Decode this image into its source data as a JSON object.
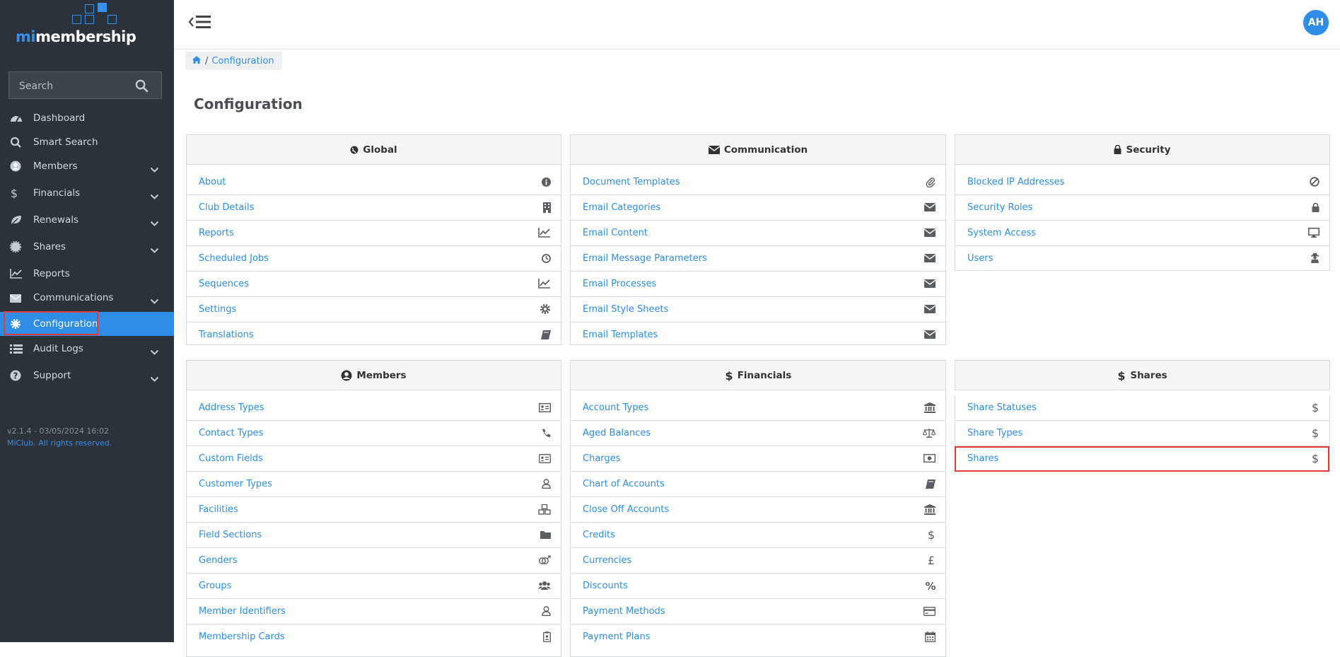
{
  "logo": {
    "mi": "mi",
    "rest": "membership"
  },
  "search": {
    "placeholder": "Search"
  },
  "nav": [
    {
      "label": "Dashboard",
      "icon": "dashboard-icon",
      "chevron": false
    },
    {
      "label": "Smart Search",
      "icon": "search-icon",
      "chevron": false
    },
    {
      "label": "Members",
      "icon": "user-circle-icon",
      "chevron": true
    },
    {
      "label": "Financials",
      "icon": "dollar-icon",
      "chevron": true
    },
    {
      "label": "Renewals",
      "icon": "leaf-icon",
      "chevron": true
    },
    {
      "label": "Shares",
      "icon": "certificate-icon",
      "chevron": true
    },
    {
      "label": "Reports",
      "icon": "line-chart-icon",
      "chevron": false
    },
    {
      "label": "Communications",
      "icon": "envelope-icon",
      "chevron": true
    },
    {
      "label": "Configuration",
      "icon": "gear-icon",
      "chevron": false,
      "active": true
    },
    {
      "label": "Audit Logs",
      "icon": "list-icon",
      "chevron": true
    },
    {
      "label": "Support",
      "icon": "question-circle-icon",
      "chevron": true
    }
  ],
  "version": {
    "text": "v2.1.4 - 03/05/2024 16:02",
    "copyright": "MiClub. All rights reserved."
  },
  "user": {
    "initials": "AH"
  },
  "breadcrumb": {
    "current": "Configuration"
  },
  "page": {
    "title": "Configuration"
  },
  "panels": [
    {
      "key": "global",
      "title": "Global",
      "icon": "globe-icon",
      "items": [
        {
          "label": "About",
          "icon": "info-circle-icon"
        },
        {
          "label": "Club Details",
          "icon": "building-icon"
        },
        {
          "label": "Reports",
          "icon": "line-chart-icon"
        },
        {
          "label": "Scheduled Jobs",
          "icon": "clock-icon"
        },
        {
          "label": "Sequences",
          "icon": "line-chart-icon"
        },
        {
          "label": "Settings",
          "icon": "gear-icon"
        },
        {
          "label": "Translations",
          "icon": "book-icon"
        }
      ]
    },
    {
      "key": "communication",
      "title": "Communication",
      "icon": "envelope-icon",
      "items": [
        {
          "label": "Document Templates",
          "icon": "paperclip-icon"
        },
        {
          "label": "Email Categories",
          "icon": "envelope-icon"
        },
        {
          "label": "Email Content",
          "icon": "envelope-icon"
        },
        {
          "label": "Email Message Parameters",
          "icon": "envelope-icon"
        },
        {
          "label": "Email Processes",
          "icon": "envelope-icon"
        },
        {
          "label": "Email Style Sheets",
          "icon": "envelope-icon"
        },
        {
          "label": "Email Templates",
          "icon": "envelope-icon"
        }
      ]
    },
    {
      "key": "security",
      "title": "Security",
      "icon": "lock-icon",
      "items": [
        {
          "label": "Blocked IP Addresses",
          "icon": "ban-icon"
        },
        {
          "label": "Security Roles",
          "icon": "lock-icon"
        },
        {
          "label": "System Access",
          "icon": "desktop-icon"
        },
        {
          "label": "Users",
          "icon": "user-secret-icon"
        }
      ]
    },
    {
      "key": "members",
      "title": "Members",
      "icon": "user-circle-icon",
      "items": [
        {
          "label": "Address Types",
          "icon": "address-card-icon"
        },
        {
          "label": "Contact Types",
          "icon": "phone-icon"
        },
        {
          "label": "Custom Fields",
          "icon": "id-card-icon"
        },
        {
          "label": "Customer Types",
          "icon": "user-icon"
        },
        {
          "label": "Facilities",
          "icon": "cubes-icon"
        },
        {
          "label": "Field Sections",
          "icon": "folder-icon"
        },
        {
          "label": "Genders",
          "icon": "genderless-icon"
        },
        {
          "label": "Groups",
          "icon": "users-icon"
        },
        {
          "label": "Member Identifiers",
          "icon": "user-icon"
        },
        {
          "label": "Membership Cards",
          "icon": "id-badge-icon"
        }
      ]
    },
    {
      "key": "financials",
      "title": "Financials",
      "icon": "dollar-icon",
      "items": [
        {
          "label": "Account Types",
          "icon": "bank-icon"
        },
        {
          "label": "Aged Balances",
          "icon": "balance-scale-icon"
        },
        {
          "label": "Charges",
          "icon": "money-icon"
        },
        {
          "label": "Chart of Accounts",
          "icon": "book-icon"
        },
        {
          "label": "Close Off Accounts",
          "icon": "bank-icon"
        },
        {
          "label": "Credits",
          "icon": "dollar-icon"
        },
        {
          "label": "Currencies",
          "icon": "pound-icon"
        },
        {
          "label": "Discounts",
          "icon": "percent-icon"
        },
        {
          "label": "Payment Methods",
          "icon": "credit-card-icon"
        },
        {
          "label": "Payment Plans",
          "icon": "calendar-icon"
        }
      ]
    },
    {
      "key": "shares",
      "title": "Shares",
      "icon": "dollar-icon",
      "items": [
        {
          "label": "Share Statuses",
          "icon": "dollar-icon"
        },
        {
          "label": "Share Types",
          "icon": "dollar-icon"
        },
        {
          "label": "Shares",
          "icon": "dollar-icon"
        }
      ]
    }
  ]
}
